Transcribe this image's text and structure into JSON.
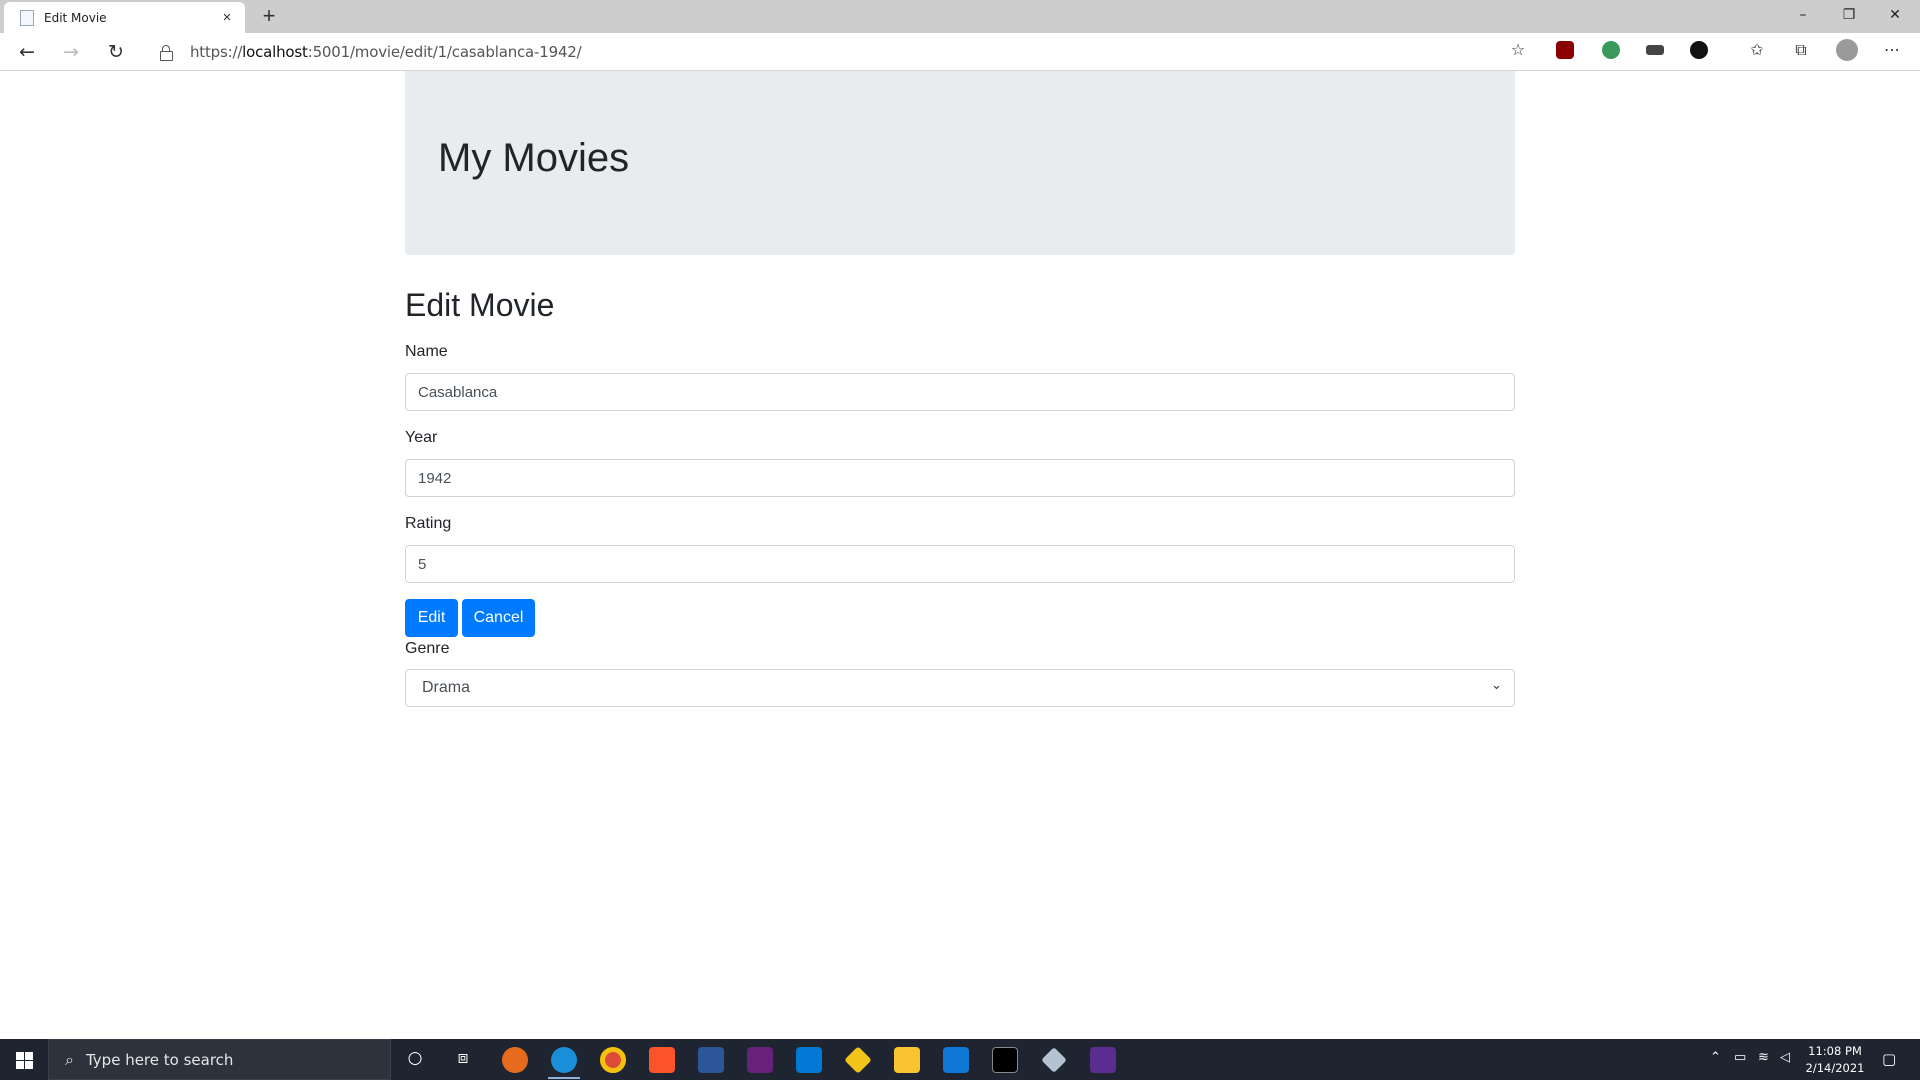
{
  "browser": {
    "tab_title": "Edit Movie",
    "tab_close": "×",
    "new_tab": "+",
    "url_scheme": "https://",
    "url_host": "localhost",
    "url_path": ":5001/movie/edit/1/casablanca-1942/",
    "window_controls": [
      "–",
      "❐",
      "✕"
    ]
  },
  "page": {
    "site_title": "My Movies",
    "heading": "Edit Movie",
    "form": {
      "name_label": "Name",
      "name_value": "Casablanca",
      "year_label": "Year",
      "year_value": "1942",
      "rating_label": "Rating",
      "rating_value": "5",
      "edit_label": "Edit",
      "cancel_label": "Cancel",
      "genre_label": "Genre",
      "genre_value": "Drama"
    },
    "colors": {
      "primary": "#007bff",
      "jumbotron": "#e9ecef"
    }
  },
  "taskbar": {
    "search_placeholder": "Type here to search",
    "time": "11:08 PM",
    "date": "2/14/2021"
  }
}
